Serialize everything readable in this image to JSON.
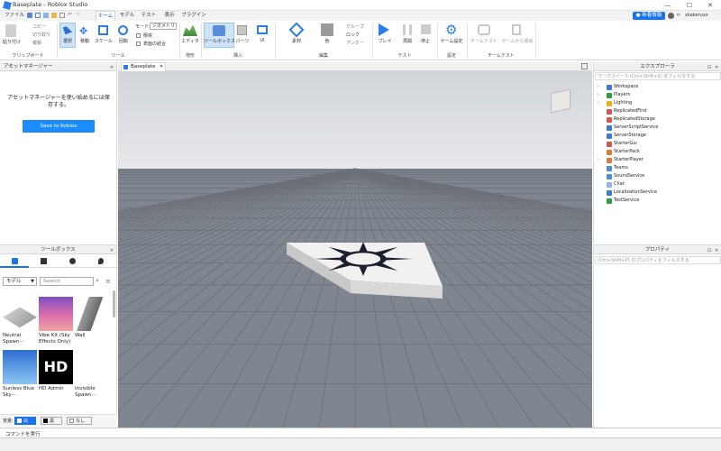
{
  "window": {
    "title": "Baseplate - Roblox Studio",
    "controls": [
      "—",
      "☐",
      "✕"
    ]
  },
  "menu": {
    "items": [
      "ファイル",
      "ホーム",
      "モデル",
      "テスト",
      "表示",
      "プラグイン"
    ],
    "active": "ホーム"
  },
  "topright": {
    "news": "新着情報",
    "user": "xkakeruxx"
  },
  "ribbon": {
    "clipboard": {
      "label": "クリップボード",
      "paste": "貼り付け",
      "copy": "コピー",
      "cut": "切り取り",
      "duplicate": "複製"
    },
    "tools": {
      "label": "ツール",
      "select": "選択",
      "move": "移動",
      "scale": "スケール",
      "rotate": "回転",
      "mode_label": "モード:",
      "mode_value": "ジオメトリ",
      "collisions": "衝突",
      "join_surfaces": "表面の結合"
    },
    "terrain": {
      "label": "地形",
      "editor": "エディタ"
    },
    "insert": {
      "label": "挿入",
      "toolbox": "ツールボックス",
      "part": "パーツ",
      "ui": "UI"
    },
    "edit": {
      "label": "編集",
      "material": "素材",
      "color": "色",
      "group": "グループ",
      "lock": "ロック",
      "anchor": "アンカー"
    },
    "test": {
      "label": "テスト",
      "play": "プレイ",
      "resume": "再開",
      "stop": "停止"
    },
    "settings": {
      "label": "設定",
      "game_settings": "ゲーム設定"
    },
    "team_test": {
      "label": "チームテスト",
      "team_test": "チームテスト",
      "exit_game": "ゲームから退出"
    }
  },
  "asset_manager": {
    "title": "アセットマネージャー",
    "message": "アセットマネージャーを使い始めるには保存する。",
    "button": "Save to Roblox"
  },
  "viewport": {
    "tab": "Baseplate"
  },
  "toolbox": {
    "title": "ツールボックス",
    "category": "モデル",
    "search_placeholder": "Search",
    "items": [
      {
        "name": "Neutral Spawn···"
      },
      {
        "name": "Vibe Kit (Sky Effects Only)"
      },
      {
        "name": "Wall"
      },
      {
        "name": "Sunless Blue Sky···"
      },
      {
        "name": "HD Admin"
      },
      {
        "name": "Invisible Spawn···"
      }
    ],
    "background_label": "背景:",
    "bg_options": [
      "白",
      "黒",
      "なし"
    ]
  },
  "explorer": {
    "title": "エクスプローラ",
    "filter_placeholder": "ワークスペース (Ctrl+Shift+X) をフィルタする",
    "items": [
      {
        "name": "Workspace",
        "color": "#3a7bd5",
        "arrow": true
      },
      {
        "name": "Players",
        "color": "#2e9e3e",
        "arrow": true
      },
      {
        "name": "Lighting",
        "color": "#e7b416",
        "arrow": true
      },
      {
        "name": "ReplicatedFirst",
        "color": "#d9534f",
        "arrow": false
      },
      {
        "name": "ReplicatedStorage",
        "color": "#d9534f",
        "arrow": false
      },
      {
        "name": "ServerScriptService",
        "color": "#3a7bd5",
        "arrow": false
      },
      {
        "name": "ServerStorage",
        "color": "#3a7bd5",
        "arrow": false
      },
      {
        "name": "StarterGui",
        "color": "#d9534f",
        "arrow": false
      },
      {
        "name": "StarterPack",
        "color": "#e07b39",
        "arrow": false
      },
      {
        "name": "StarterPlayer",
        "color": "#e07b39",
        "arrow": true
      },
      {
        "name": "Teams",
        "color": "#4a90d9",
        "arrow": false
      },
      {
        "name": "SoundService",
        "color": "#4a90d9",
        "arrow": false
      },
      {
        "name": "Chat",
        "color": "#8ab4e8",
        "arrow": false
      },
      {
        "name": "LocalizationService",
        "color": "#3a7bd5",
        "arrow": false
      },
      {
        "name": "TestService",
        "color": "#2e9e3e",
        "arrow": false
      }
    ]
  },
  "properties": {
    "title": "プロパティ",
    "filter_placeholder": "(Ctrl+Shift+P) のプロパティをフィルタする"
  },
  "command_bar": {
    "placeholder": "コマンドを実行"
  }
}
